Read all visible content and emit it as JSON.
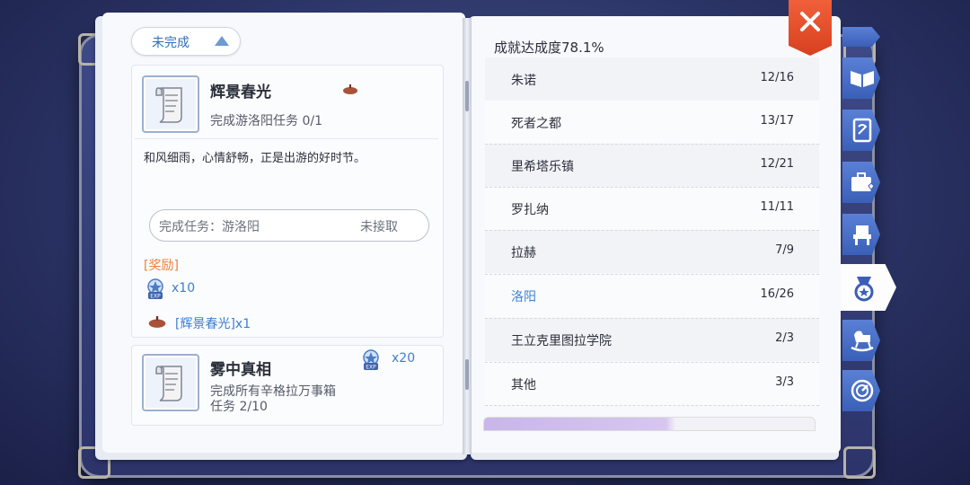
{
  "filter": {
    "label": "未完成"
  },
  "quests": [
    {
      "title": "辉景春光",
      "subtitle": "完成游洛阳任务 0/1",
      "description": "和风细雨，心情舒畅，正是出游的好时节。",
      "task_label": "完成任务：游洛阳",
      "task_status": "未接取",
      "reward_heading": "[奖励]",
      "exp_reward": "x10",
      "item_reward": "[辉景春光]x1"
    },
    {
      "title": "雾中真相",
      "subtitle_line1": "完成所有辛格拉万事箱",
      "subtitle_line2": "任务 2/10",
      "exp_reward": "x20"
    }
  ],
  "achievement": {
    "rate_text": "成就达成度78.1%",
    "regions": [
      {
        "name": "朱诺",
        "count": "12/16"
      },
      {
        "name": "死者之都",
        "count": "13/17"
      },
      {
        "name": "里希塔乐镇",
        "count": "12/21"
      },
      {
        "name": "罗扎纳",
        "count": "11/11"
      },
      {
        "name": "拉赫",
        "count": "7/9"
      },
      {
        "name": "洛阳",
        "count": "16/26"
      },
      {
        "name": "王立克里图拉学院",
        "count": "2/3"
      },
      {
        "name": "其他",
        "count": "3/3"
      }
    ],
    "active_region": "洛阳"
  },
  "side_tabs": [
    "book-icon",
    "card-icon",
    "briefcase-icon",
    "chair-icon",
    "medal-icon",
    "rocking-horse-icon",
    "gauge-icon"
  ],
  "active_tab": "medal-icon",
  "colors": {
    "accent_blue": "#3c82d2",
    "reward_orange": "#ef7f3a",
    "close_red": "#e24e2a",
    "tab_blue": "#4a6fc7"
  }
}
